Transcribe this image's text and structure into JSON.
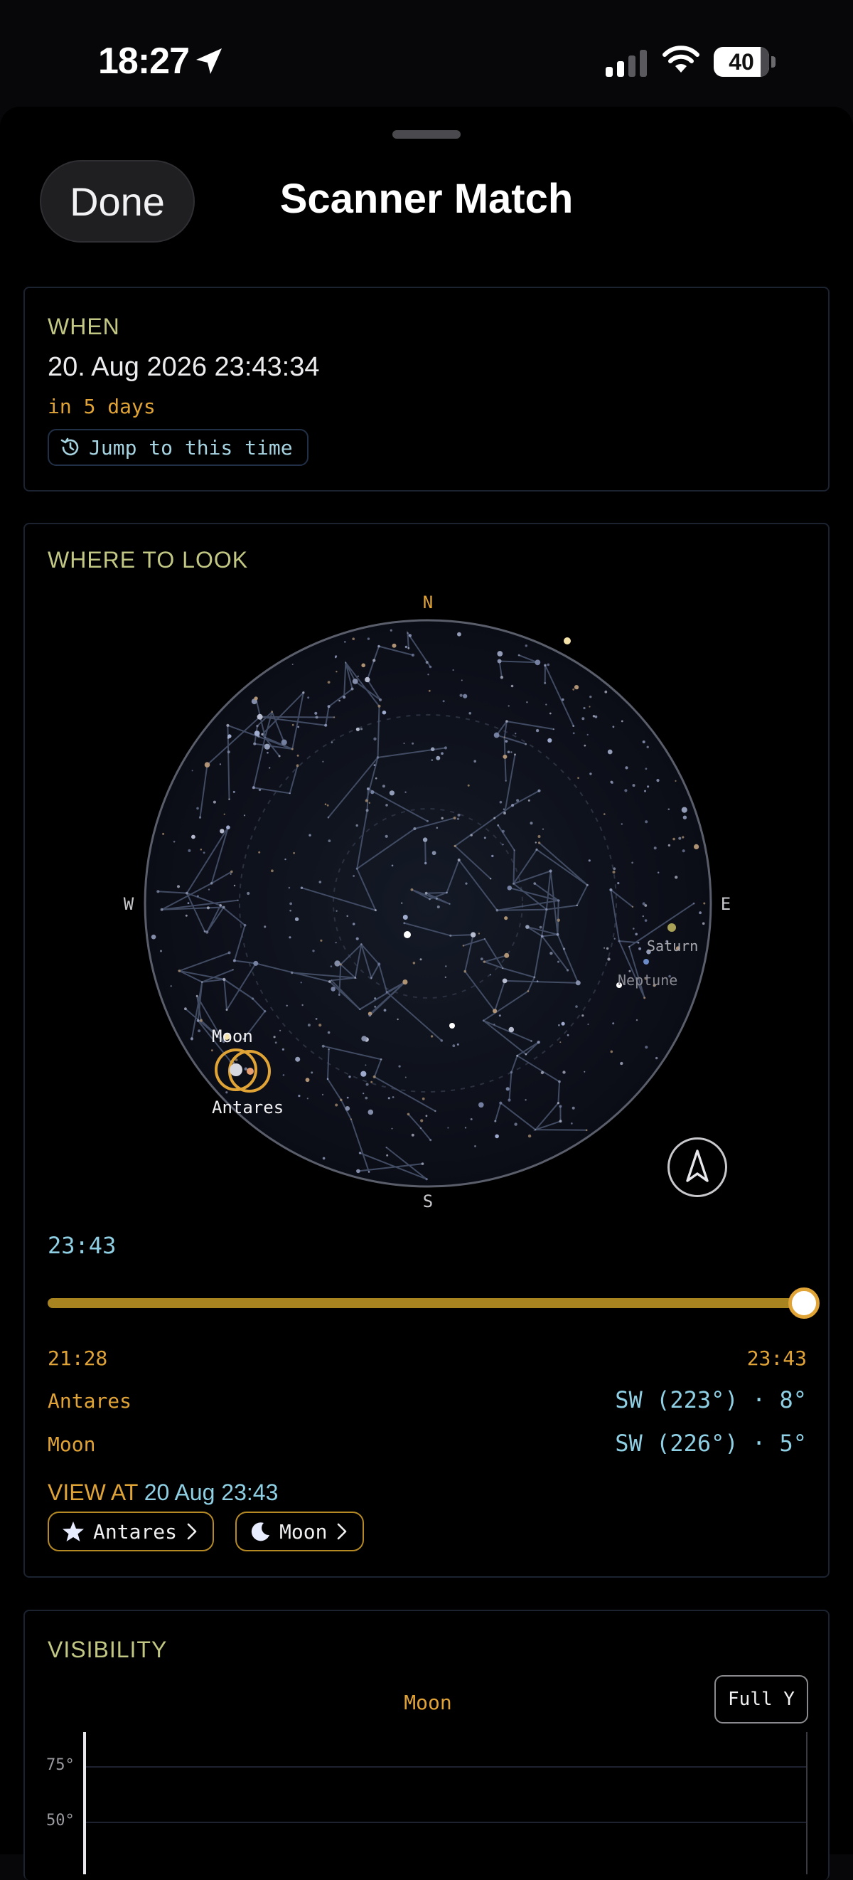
{
  "status_bar": {
    "time": "18:27",
    "battery": "40"
  },
  "header": {
    "done_label": "Done",
    "title": "Scanner Match"
  },
  "when": {
    "title": "WHEN",
    "datetime": "20. Aug 2026 23:43:34",
    "relative": "in 5 days",
    "jump_label": "Jump to this time"
  },
  "where": {
    "title": "WHERE TO LOOK",
    "compass": {
      "n": "N",
      "s": "S",
      "e": "E",
      "w": "W"
    },
    "labels": {
      "saturn": "Saturn",
      "neptune": "Neptune",
      "moon": "Moon",
      "antares": "Antares"
    },
    "current_time": "23:43",
    "slider_fraction": 1.0,
    "range_start": "21:28",
    "range_end": "23:43",
    "rows": [
      {
        "name": "Antares",
        "value": "SW (223°) · 8°"
      },
      {
        "name": "Moon",
        "value": "SW (226°) · 5°"
      }
    ],
    "view_at_label": "VIEW AT",
    "view_at_time": "20 Aug 23:43",
    "buttons": [
      {
        "label": "Antares",
        "icon": "star-icon"
      },
      {
        "label": "Moon",
        "icon": "moon-icon"
      }
    ]
  },
  "visibility": {
    "title": "VISIBILITY",
    "target": "Moon",
    "full_label": "Full Y",
    "y_ticks": [
      "75°",
      "50°"
    ]
  },
  "colors": {
    "accent_orange": "#e0a336",
    "accent_cyan": "#8ecfe4",
    "section_title": "#c2c784"
  }
}
